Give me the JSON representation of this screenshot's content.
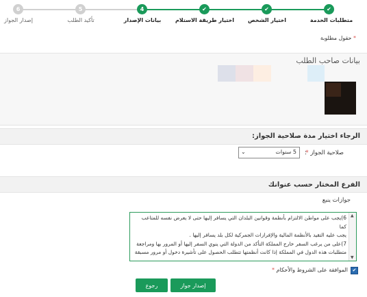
{
  "stepper": {
    "steps": [
      {
        "number": "✔",
        "label": "متطلبات الخدمة",
        "state": "done"
      },
      {
        "number": "✔",
        "label": "اختيار الشخص",
        "state": "done"
      },
      {
        "number": "✔",
        "label": "اختيار طريقة الاستلام",
        "state": "done"
      },
      {
        "number": "4",
        "label": "بيانات الإصدار",
        "state": "done"
      },
      {
        "number": "5",
        "label": "تأكيد الطلب",
        "state": "todo"
      },
      {
        "number": "6",
        "label": "إصدار الجواز",
        "state": "todo"
      }
    ]
  },
  "required_note": "حقول مطلوبة",
  "applicant": {
    "title": "بيانات صاحب الطلب"
  },
  "validity": {
    "title": "الرجاء اختيار مدة صلاحية الجواز:",
    "field_label": "صلاحية الجواز",
    "selected": "5 سنوات"
  },
  "branch": {
    "title": "الفرع المختار حسب عنوانك",
    "value": "جوازات ينبع"
  },
  "terms": {
    "lines": [
      "6)يجب على مواطن الالتزام بأنظمة وقوانين البلدان التي يسافر إليها حتى لا يعرض نفسه للمتاعب كما",
      "يجب عليه التقيد بالأنظمة المالية والإفرازات الجمركية لكل بلد يسافر إليها .",
      "7)على من يرغب السفر خارج المملكة التأكد من الدولة التي ينوي السفر إليها أو المرور بها ومراجعة",
      "متطلبات هذه الدول في المملكة إذا كانت أنظمتها تتطلب الحصول على تأشيرة دخول أو مرور مسبقة ."
    ]
  },
  "agree_label": "الموافقة على الشروط والأحكام",
  "buttons": {
    "issue": "إصدار جواز",
    "back": "رجوع"
  },
  "colors": {
    "accent": "#1a9a5a",
    "required": "#d9534f"
  }
}
